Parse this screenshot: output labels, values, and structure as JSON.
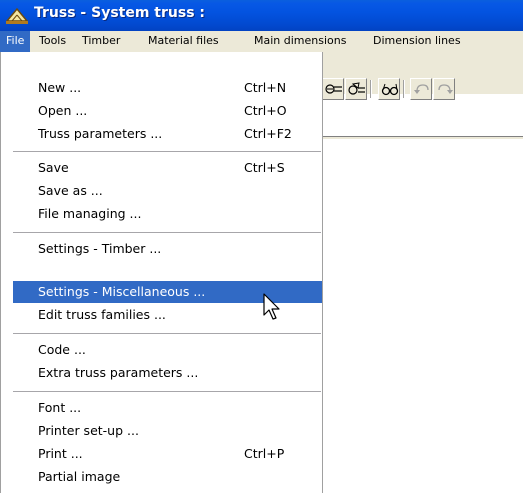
{
  "window": {
    "title": "Truss - System truss :"
  },
  "menubar": {
    "items": [
      {
        "label": "File",
        "active": true
      },
      {
        "label": "Tools"
      },
      {
        "label": "Timber"
      },
      {
        "label": "Material files"
      },
      {
        "label": "Main dimensions"
      },
      {
        "label": "Dimension lines"
      }
    ]
  },
  "toolbar": {
    "icons": [
      "truss-node-icon",
      "truss-copy-icon",
      "glasses-view-icon",
      "undo-icon",
      "redo-icon"
    ]
  },
  "file_menu": {
    "items": [
      {
        "label": "New ...",
        "shortcut": "Ctrl+N"
      },
      {
        "label": "Open ...",
        "shortcut": "Ctrl+O"
      },
      {
        "label": "Truss parameters ...",
        "shortcut": "Ctrl+F2"
      },
      {
        "label": "Save",
        "shortcut": "Ctrl+S"
      },
      {
        "label": "Save as ...",
        "shortcut": ""
      },
      {
        "label": "File managing ...",
        "shortcut": ""
      },
      {
        "label": "Settings - Timber ...",
        "shortcut": ""
      },
      {
        "label": "Settings - Miscellaneous ...",
        "shortcut": "",
        "highlighted": true
      },
      {
        "label": "Edit truss families ...",
        "shortcut": ""
      },
      {
        "label": "Code ...",
        "shortcut": ""
      },
      {
        "label": "Extra truss parameters ...",
        "shortcut": ""
      },
      {
        "label": "Font ...",
        "shortcut": ""
      },
      {
        "label": "Printer set-up ...",
        "shortcut": ""
      },
      {
        "label": "Print ...",
        "shortcut": "Ctrl+P"
      },
      {
        "label": "Partial image",
        "shortcut": ""
      }
    ]
  },
  "colors": {
    "titlebar": "#0353e0",
    "menu_highlight": "#316ac5",
    "chrome": "#ece9d8"
  }
}
